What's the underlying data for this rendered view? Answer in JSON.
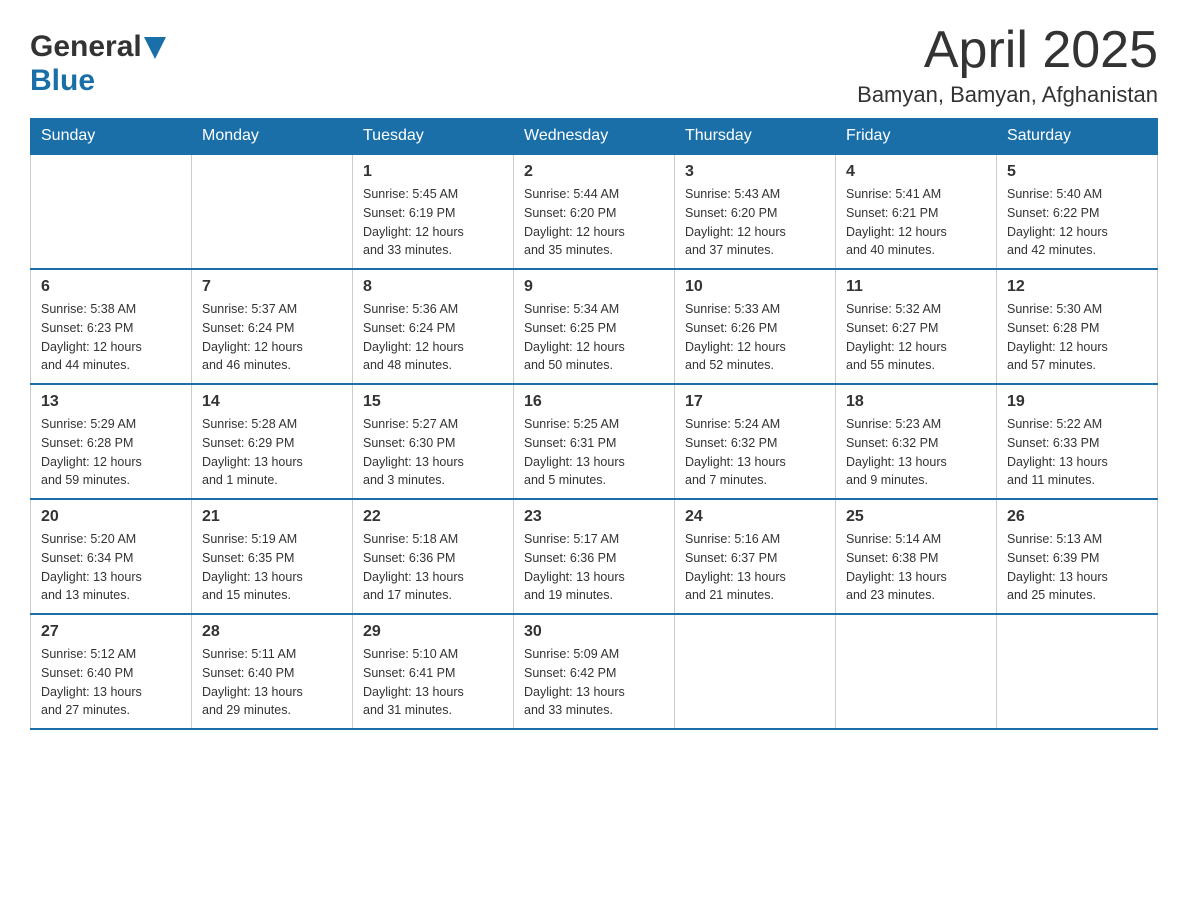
{
  "header": {
    "logo_general": "General",
    "logo_blue": "Blue",
    "month": "April 2025",
    "location": "Bamyan, Bamyan, Afghanistan"
  },
  "days_of_week": [
    "Sunday",
    "Monday",
    "Tuesday",
    "Wednesday",
    "Thursday",
    "Friday",
    "Saturday"
  ],
  "weeks": [
    [
      {
        "day": "",
        "info": ""
      },
      {
        "day": "",
        "info": ""
      },
      {
        "day": "1",
        "info": "Sunrise: 5:45 AM\nSunset: 6:19 PM\nDaylight: 12 hours\nand 33 minutes."
      },
      {
        "day": "2",
        "info": "Sunrise: 5:44 AM\nSunset: 6:20 PM\nDaylight: 12 hours\nand 35 minutes."
      },
      {
        "day": "3",
        "info": "Sunrise: 5:43 AM\nSunset: 6:20 PM\nDaylight: 12 hours\nand 37 minutes."
      },
      {
        "day": "4",
        "info": "Sunrise: 5:41 AM\nSunset: 6:21 PM\nDaylight: 12 hours\nand 40 minutes."
      },
      {
        "day": "5",
        "info": "Sunrise: 5:40 AM\nSunset: 6:22 PM\nDaylight: 12 hours\nand 42 minutes."
      }
    ],
    [
      {
        "day": "6",
        "info": "Sunrise: 5:38 AM\nSunset: 6:23 PM\nDaylight: 12 hours\nand 44 minutes."
      },
      {
        "day": "7",
        "info": "Sunrise: 5:37 AM\nSunset: 6:24 PM\nDaylight: 12 hours\nand 46 minutes."
      },
      {
        "day": "8",
        "info": "Sunrise: 5:36 AM\nSunset: 6:24 PM\nDaylight: 12 hours\nand 48 minutes."
      },
      {
        "day": "9",
        "info": "Sunrise: 5:34 AM\nSunset: 6:25 PM\nDaylight: 12 hours\nand 50 minutes."
      },
      {
        "day": "10",
        "info": "Sunrise: 5:33 AM\nSunset: 6:26 PM\nDaylight: 12 hours\nand 52 minutes."
      },
      {
        "day": "11",
        "info": "Sunrise: 5:32 AM\nSunset: 6:27 PM\nDaylight: 12 hours\nand 55 minutes."
      },
      {
        "day": "12",
        "info": "Sunrise: 5:30 AM\nSunset: 6:28 PM\nDaylight: 12 hours\nand 57 minutes."
      }
    ],
    [
      {
        "day": "13",
        "info": "Sunrise: 5:29 AM\nSunset: 6:28 PM\nDaylight: 12 hours\nand 59 minutes."
      },
      {
        "day": "14",
        "info": "Sunrise: 5:28 AM\nSunset: 6:29 PM\nDaylight: 13 hours\nand 1 minute."
      },
      {
        "day": "15",
        "info": "Sunrise: 5:27 AM\nSunset: 6:30 PM\nDaylight: 13 hours\nand 3 minutes."
      },
      {
        "day": "16",
        "info": "Sunrise: 5:25 AM\nSunset: 6:31 PM\nDaylight: 13 hours\nand 5 minutes."
      },
      {
        "day": "17",
        "info": "Sunrise: 5:24 AM\nSunset: 6:32 PM\nDaylight: 13 hours\nand 7 minutes."
      },
      {
        "day": "18",
        "info": "Sunrise: 5:23 AM\nSunset: 6:32 PM\nDaylight: 13 hours\nand 9 minutes."
      },
      {
        "day": "19",
        "info": "Sunrise: 5:22 AM\nSunset: 6:33 PM\nDaylight: 13 hours\nand 11 minutes."
      }
    ],
    [
      {
        "day": "20",
        "info": "Sunrise: 5:20 AM\nSunset: 6:34 PM\nDaylight: 13 hours\nand 13 minutes."
      },
      {
        "day": "21",
        "info": "Sunrise: 5:19 AM\nSunset: 6:35 PM\nDaylight: 13 hours\nand 15 minutes."
      },
      {
        "day": "22",
        "info": "Sunrise: 5:18 AM\nSunset: 6:36 PM\nDaylight: 13 hours\nand 17 minutes."
      },
      {
        "day": "23",
        "info": "Sunrise: 5:17 AM\nSunset: 6:36 PM\nDaylight: 13 hours\nand 19 minutes."
      },
      {
        "day": "24",
        "info": "Sunrise: 5:16 AM\nSunset: 6:37 PM\nDaylight: 13 hours\nand 21 minutes."
      },
      {
        "day": "25",
        "info": "Sunrise: 5:14 AM\nSunset: 6:38 PM\nDaylight: 13 hours\nand 23 minutes."
      },
      {
        "day": "26",
        "info": "Sunrise: 5:13 AM\nSunset: 6:39 PM\nDaylight: 13 hours\nand 25 minutes."
      }
    ],
    [
      {
        "day": "27",
        "info": "Sunrise: 5:12 AM\nSunset: 6:40 PM\nDaylight: 13 hours\nand 27 minutes."
      },
      {
        "day": "28",
        "info": "Sunrise: 5:11 AM\nSunset: 6:40 PM\nDaylight: 13 hours\nand 29 minutes."
      },
      {
        "day": "29",
        "info": "Sunrise: 5:10 AM\nSunset: 6:41 PM\nDaylight: 13 hours\nand 31 minutes."
      },
      {
        "day": "30",
        "info": "Sunrise: 5:09 AM\nSunset: 6:42 PM\nDaylight: 13 hours\nand 33 minutes."
      },
      {
        "day": "",
        "info": ""
      },
      {
        "day": "",
        "info": ""
      },
      {
        "day": "",
        "info": ""
      }
    ]
  ]
}
